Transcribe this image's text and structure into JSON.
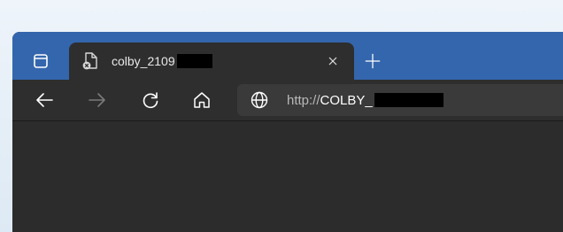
{
  "browser": {
    "tab": {
      "title": "colby_2109",
      "favicon": "document-error-icon",
      "close_glyph": "×"
    },
    "new_tab_glyph": "+",
    "toolbar": {
      "back_icon": "back-arrow-icon",
      "forward_icon": "forward-arrow-icon",
      "refresh_icon": "refresh-icon",
      "home_icon": "home-icon"
    },
    "address": {
      "scheme": "http://",
      "host": "COLBY_",
      "site_icon": "globe-icon"
    }
  },
  "colors": {
    "tabstrip": "#3466ad",
    "toolbar": "#2e2e2e",
    "address_bar": "#3a3a3a",
    "content": "#2c2c2c"
  }
}
